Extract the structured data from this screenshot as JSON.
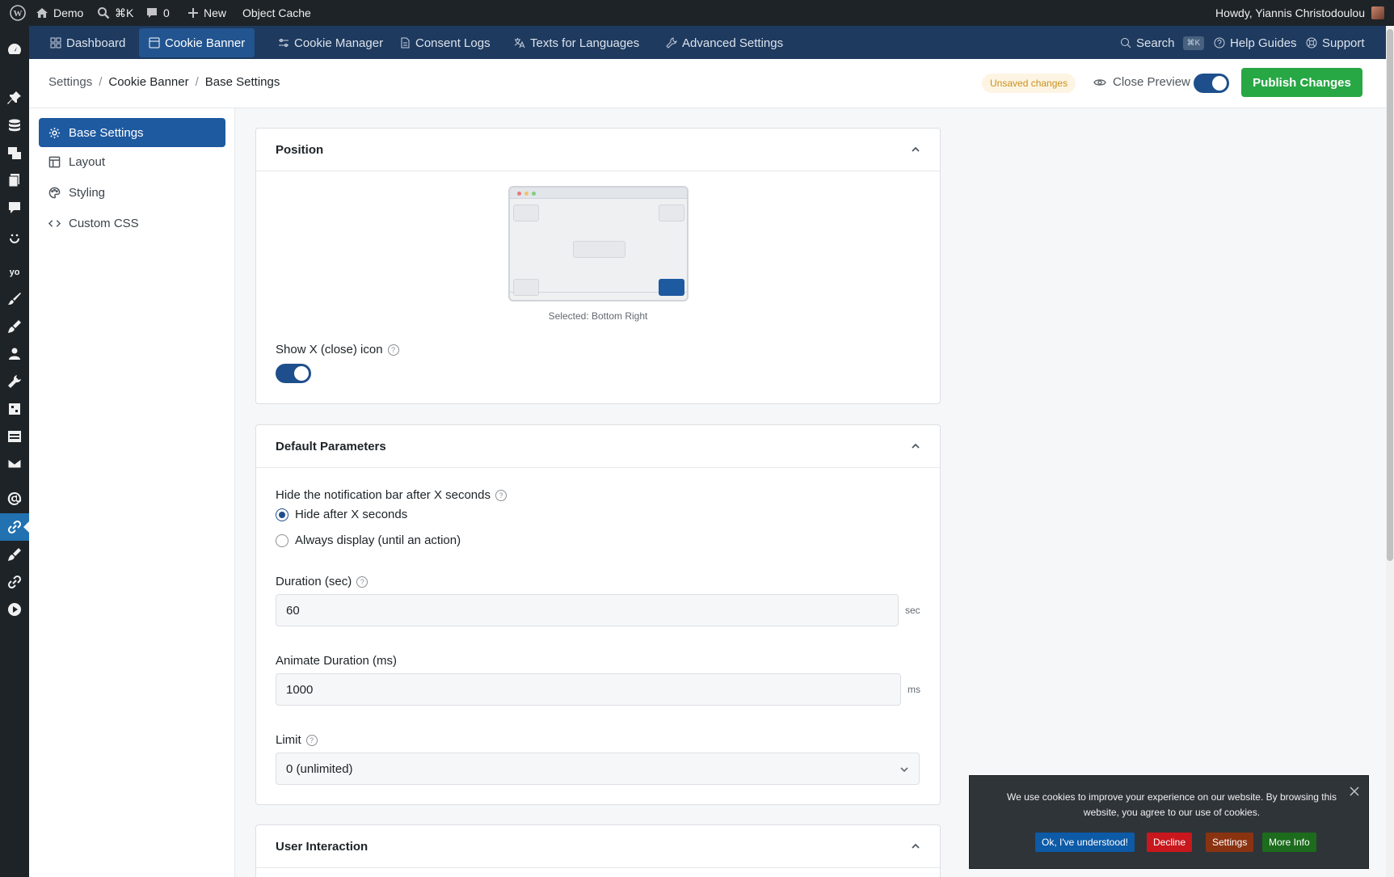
{
  "adminbar": {
    "site_name": "Demo",
    "search_shortcut": "⌘K",
    "comments_count": "0",
    "new_label": "New",
    "object_cache": "Object Cache",
    "howdy": "Howdy, Yiannis Christodoulou"
  },
  "wp_sidebar_icons": [
    "dashboard-icon",
    "pin-icon",
    "database-icon",
    "media-icon",
    "pages-icon",
    "comments-icon",
    "smile-icon",
    "yoast-icon",
    "brush-icon",
    "appearance-icon",
    "users-icon",
    "tools-icon",
    "plugins-icon",
    "table-icon",
    "mail-icon",
    "at-icon",
    "link-icon",
    "hammer-icon",
    "link-icon",
    "play-icon"
  ],
  "nav": {
    "dashboard": "Dashboard",
    "cookie_banner": "Cookie Banner",
    "cookie_manager": "Cookie Manager",
    "consent_logs": "Consent Logs",
    "texts_for_languages": "Texts for Languages",
    "advanced_settings": "Advanced Settings",
    "search": "Search",
    "search_kbd": "⌘K",
    "help_guides": "Help Guides",
    "support": "Support"
  },
  "header": {
    "breadcrumb": [
      "Settings",
      "Cookie Banner",
      "Base Settings"
    ],
    "unsaved": "Unsaved changes",
    "close_preview": "Close Preview",
    "preview_on": true,
    "publish": "Publish Changes"
  },
  "sidebar": {
    "items": [
      {
        "label": "Base Settings",
        "active": true
      },
      {
        "label": "Layout"
      },
      {
        "label": "Styling"
      },
      {
        "label": "Custom CSS"
      }
    ]
  },
  "position": {
    "title": "Position",
    "selected_text": "Selected: Bottom Right",
    "show_x_label": "Show X (close) icon",
    "show_x_on": true
  },
  "default_params": {
    "title": "Default Parameters",
    "hide_label": "Hide the notification bar after X seconds",
    "radio_hide": "Hide after X seconds",
    "radio_always": "Always display (until an action)",
    "duration_label": "Duration (sec)",
    "duration_value": "60",
    "duration_unit": "sec",
    "animate_label": "Animate Duration (ms)",
    "animate_value": "1000",
    "animate_unit": "ms",
    "limit_label": "Limit",
    "limit_value": "0 (unlimited)"
  },
  "user_interaction": {
    "title": "User Interaction"
  },
  "cookie_banner": {
    "message": "We use cookies to improve your experience on our website. By browsing this website, you agree to our use of cookies.",
    "ok": "Ok, I've understood!",
    "decline": "Decline",
    "settings": "Settings",
    "more_info": "More Info",
    "colors": {
      "ok": "#0d5aa7",
      "decline": "#c8181d",
      "settings": "#8a3311",
      "more_info": "#1d6b1d"
    }
  },
  "colors": {
    "nav_bg": "#1e3a5f",
    "primary": "#1e5aa0",
    "publish": "#28a745"
  }
}
